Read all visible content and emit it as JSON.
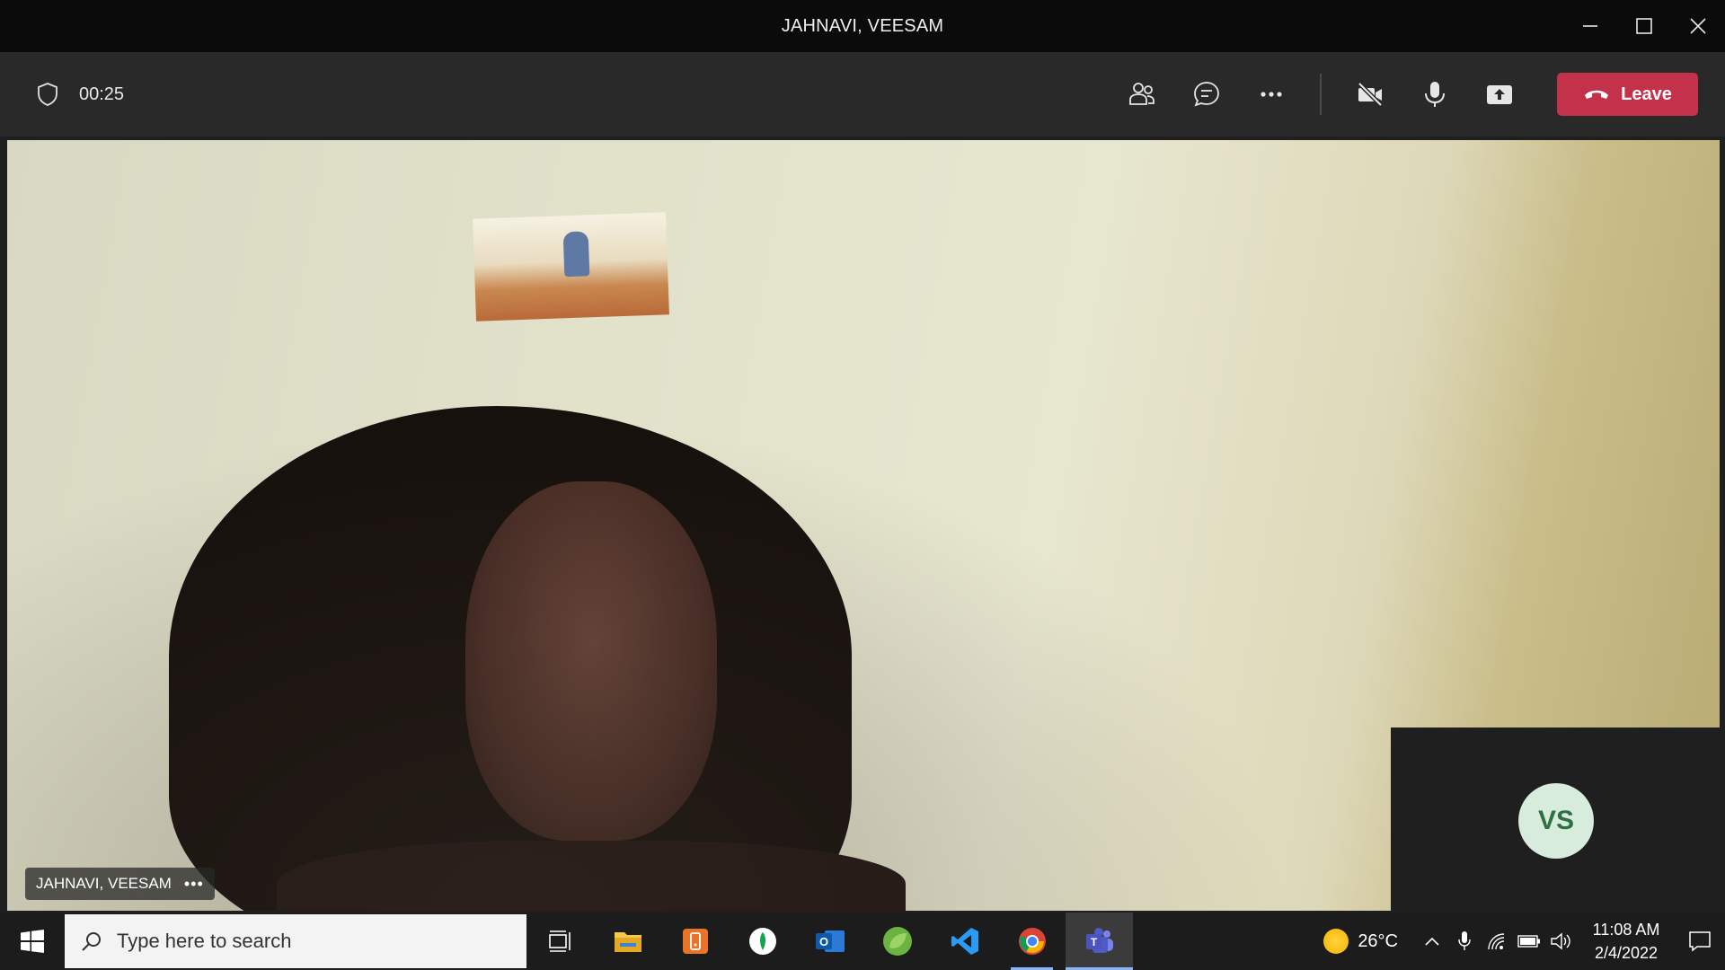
{
  "window": {
    "title": "JAHNAVI, VEESAM"
  },
  "meeting": {
    "timer": "00:25",
    "leave_label": "Leave",
    "participant_name": "JAHNAVI, VEESAM",
    "participant_more": "•••",
    "self_initials": "VS",
    "toolbar_icons": [
      "participants-icon",
      "chat-icon",
      "more-actions-icon",
      "camera-off-icon",
      "microphone-icon",
      "share-screen-icon"
    ]
  },
  "taskbar": {
    "search_placeholder": "Type here to search",
    "apps": [
      "task-view",
      "file-explorer",
      "app-orange",
      "app-green-circle",
      "outlook",
      "spring-tool-suite",
      "visual-studio-code",
      "chrome",
      "microsoft-teams"
    ],
    "active_app": "microsoft-teams",
    "weather": "26°C",
    "time": "11:08 AM",
    "date": "2/4/2022"
  },
  "colors": {
    "leave_button": "#c4314b",
    "toolbar_bg": "#292929",
    "titlebar_bg": "#0b0b0b",
    "avatar_bg": "#d7ecdd",
    "avatar_text": "#2f6f45"
  }
}
